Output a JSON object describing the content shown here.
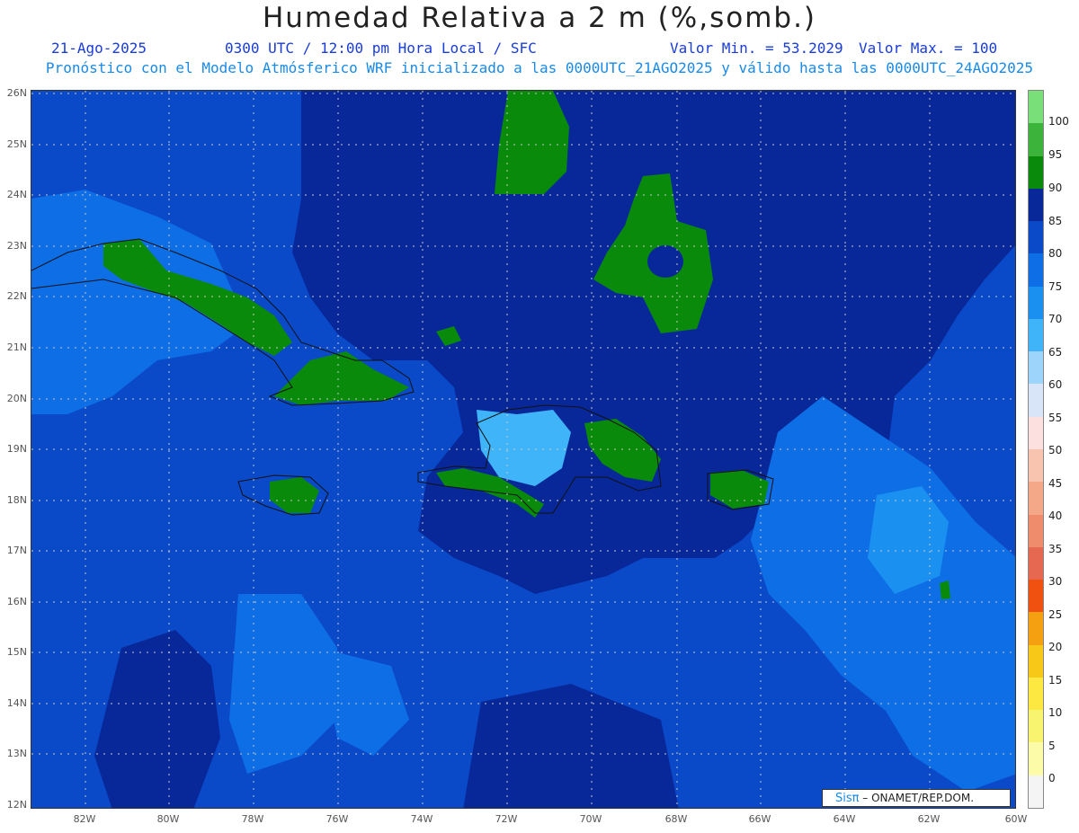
{
  "title": "Humedad Relativa a 2 m (%,somb.)",
  "header": {
    "date": "21-Ago-2025",
    "time": "0300 UTC / 12:00 pm Hora Local / SFC",
    "min": "Valor Min. = 53.2029",
    "max": "Valor Max. = 100"
  },
  "subtitle": "Pronóstico con el Modelo Atmósferico WRF inicializado a las 0000UTC_21AGO2025 y válido hasta las  0000UTC_24AGO2025",
  "lat_labels": [
    "26N",
    "25N",
    "24N",
    "23N",
    "22N",
    "21N",
    "20N",
    "19N",
    "18N",
    "17N",
    "16N",
    "15N",
    "14N",
    "13N",
    "12N"
  ],
  "lon_labels": [
    "82W",
    "80W",
    "78W",
    "76W",
    "74W",
    "72W",
    "70W",
    "68W",
    "66W",
    "64W",
    "62W",
    "60W"
  ],
  "colorbar": {
    "labels": [
      "100",
      "95",
      "90",
      "85",
      "80",
      "75",
      "70",
      "65",
      "60",
      "55",
      "50",
      "45",
      "40",
      "35",
      "30",
      "25",
      "20",
      "15",
      "10",
      "5",
      "0"
    ],
    "colors": [
      "#79e079",
      "#3cb43c",
      "#0a8a0a",
      "#08289a",
      "#0a4ac8",
      "#0e6ee6",
      "#1a90f0",
      "#40b4f8",
      "#9cd4fc",
      "#d8e4f8",
      "#fce0e0",
      "#f8c4b0",
      "#f4a888",
      "#ee8c6c",
      "#e66850",
      "#f05010",
      "#f4a010",
      "#f8c818",
      "#fce840",
      "#f8f470",
      "#fcfca8",
      "#f4f4f4"
    ]
  },
  "credit": {
    "logo": "Sisπ",
    "text": "– ONAMET/REP.DOM."
  }
}
